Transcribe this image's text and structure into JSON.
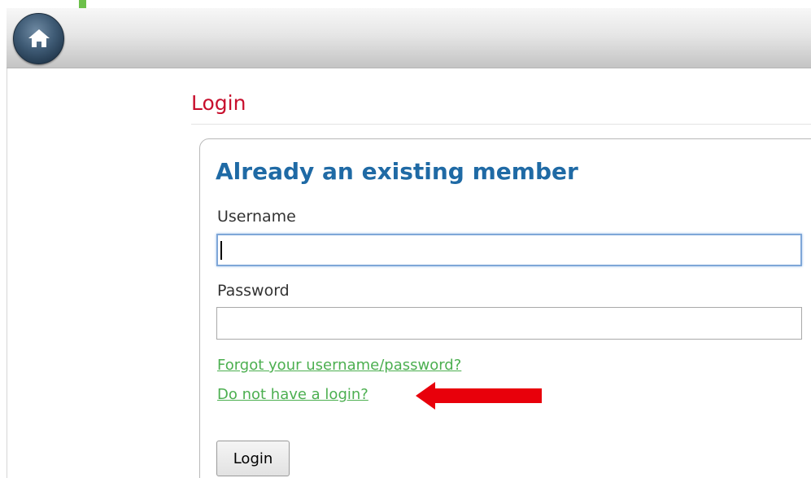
{
  "header": {
    "home_icon": "home-icon"
  },
  "page": {
    "title": "Login"
  },
  "login_panel": {
    "heading": "Already an existing member",
    "username": {
      "label": "Username",
      "value": "",
      "placeholder": ""
    },
    "password": {
      "label": "Password",
      "value": "",
      "placeholder": ""
    },
    "forgot_link": "Forgot your username/password?",
    "register_link": "Do not have a login?",
    "submit_label": "Login"
  },
  "colors": {
    "title": "#c8102e",
    "heading": "#1f6aa5",
    "link": "#4caf50",
    "annotation_arrow": "#e8000b",
    "accent_green": "#6cc04a"
  },
  "annotation": {
    "type": "arrow",
    "direction": "left",
    "target": "register_link"
  }
}
